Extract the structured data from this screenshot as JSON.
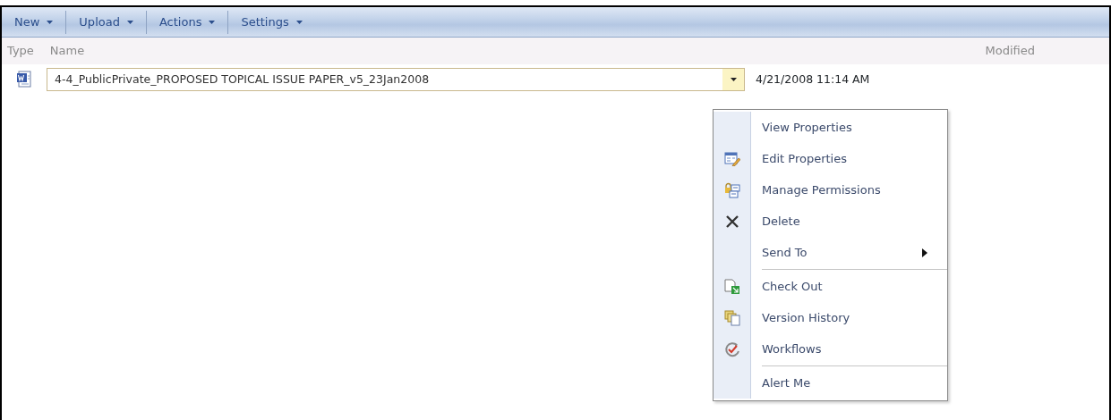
{
  "toolbar": {
    "buttons": [
      {
        "label": "New",
        "has_dropdown": true
      },
      {
        "label": "Upload",
        "has_dropdown": true
      },
      {
        "label": "Actions",
        "has_dropdown": true
      },
      {
        "label": "Settings",
        "has_dropdown": true
      }
    ]
  },
  "table": {
    "columns": [
      "Type",
      "Name",
      "Modified"
    ],
    "rows": [
      {
        "name": "4-4_PublicPrivate_PROPOSED TOPICAL ISSUE PAPER_v5_23Jan2008",
        "modified": "4/21/2008 11:14 AM",
        "menu_open": true
      }
    ]
  },
  "context_menu": {
    "items": [
      {
        "label": "View Properties",
        "separator_before": false,
        "has_submenu": false
      },
      {
        "label": "Edit Properties",
        "separator_before": false,
        "has_submenu": false
      },
      {
        "label": "Manage Permissions",
        "separator_before": false,
        "has_submenu": false
      },
      {
        "label": "Delete",
        "separator_before": false,
        "has_submenu": false
      },
      {
        "label": "Send To",
        "separator_before": false,
        "has_submenu": true
      },
      {
        "label": "Check Out",
        "separator_before": true,
        "has_submenu": false
      },
      {
        "label": "Version History",
        "separator_before": false,
        "has_submenu": false
      },
      {
        "label": "Workflows",
        "separator_before": false,
        "has_submenu": false
      },
      {
        "label": "Alert Me",
        "separator_before": true,
        "has_submenu": false
      }
    ]
  }
}
